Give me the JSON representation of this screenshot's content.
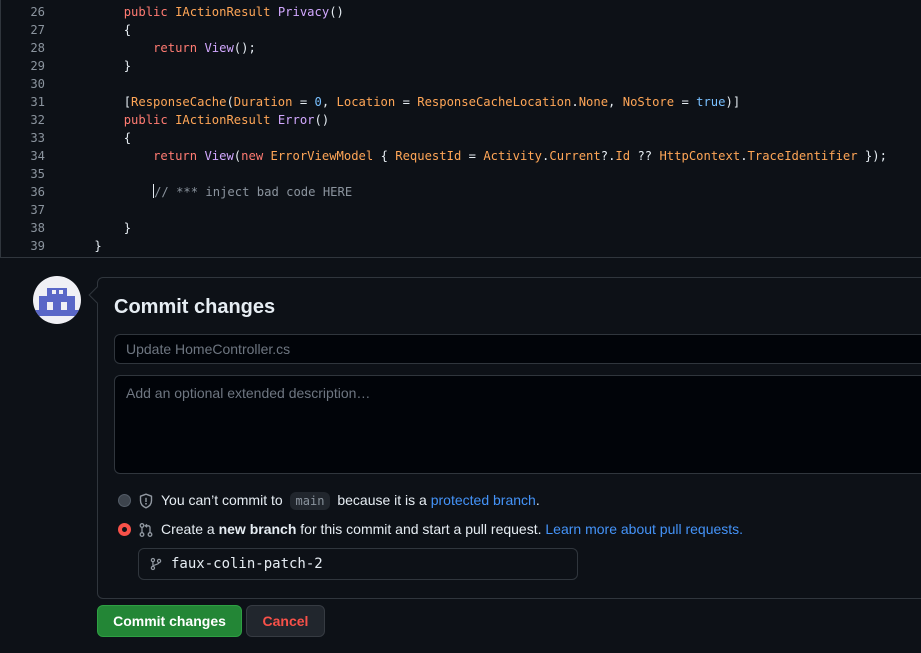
{
  "editor": {
    "lines": [
      {
        "num": "26",
        "indent": "        ",
        "tokens": [
          {
            "c": "k",
            "t": "public "
          },
          {
            "c": "t",
            "t": "IActionResult "
          },
          {
            "c": "f",
            "t": "Privacy"
          },
          {
            "c": "p",
            "t": "()"
          }
        ]
      },
      {
        "num": "27",
        "indent": "        ",
        "tokens": [
          {
            "c": "p",
            "t": "{"
          }
        ]
      },
      {
        "num": "28",
        "indent": "            ",
        "tokens": [
          {
            "c": "k",
            "t": "return "
          },
          {
            "c": "f",
            "t": "View"
          },
          {
            "c": "p",
            "t": "();"
          }
        ]
      },
      {
        "num": "29",
        "indent": "        ",
        "tokens": [
          {
            "c": "p",
            "t": "}"
          }
        ]
      },
      {
        "num": "30",
        "indent": "",
        "tokens": []
      },
      {
        "num": "31",
        "indent": "        ",
        "tokens": [
          {
            "c": "p",
            "t": "["
          },
          {
            "c": "t",
            "t": "ResponseCache"
          },
          {
            "c": "p",
            "t": "("
          },
          {
            "c": "t",
            "t": "Duration"
          },
          {
            "c": "p",
            "t": " = "
          },
          {
            "c": "n",
            "t": "0"
          },
          {
            "c": "p",
            "t": ", "
          },
          {
            "c": "t",
            "t": "Location"
          },
          {
            "c": "p",
            "t": " = "
          },
          {
            "c": "t",
            "t": "ResponseCacheLocation"
          },
          {
            "c": "p",
            "t": "."
          },
          {
            "c": "t",
            "t": "None"
          },
          {
            "c": "p",
            "t": ", "
          },
          {
            "c": "t",
            "t": "NoStore"
          },
          {
            "c": "p",
            "t": " = "
          },
          {
            "c": "n",
            "t": "true"
          },
          {
            "c": "p",
            "t": ")]"
          }
        ]
      },
      {
        "num": "32",
        "indent": "        ",
        "tokens": [
          {
            "c": "k",
            "t": "public "
          },
          {
            "c": "t",
            "t": "IActionResult "
          },
          {
            "c": "f",
            "t": "Error"
          },
          {
            "c": "p",
            "t": "()"
          }
        ]
      },
      {
        "num": "33",
        "indent": "        ",
        "tokens": [
          {
            "c": "p",
            "t": "{"
          }
        ]
      },
      {
        "num": "34",
        "indent": "            ",
        "tokens": [
          {
            "c": "k",
            "t": "return "
          },
          {
            "c": "f",
            "t": "View"
          },
          {
            "c": "p",
            "t": "("
          },
          {
            "c": "k",
            "t": "new "
          },
          {
            "c": "t",
            "t": "ErrorViewModel"
          },
          {
            "c": "p",
            "t": " { "
          },
          {
            "c": "t",
            "t": "RequestId"
          },
          {
            "c": "p",
            "t": " = "
          },
          {
            "c": "t",
            "t": "Activity"
          },
          {
            "c": "p",
            "t": "."
          },
          {
            "c": "t",
            "t": "Current"
          },
          {
            "c": "p",
            "t": "?."
          },
          {
            "c": "t",
            "t": "Id"
          },
          {
            "c": "p",
            "t": " ?? "
          },
          {
            "c": "t",
            "t": "HttpContext"
          },
          {
            "c": "p",
            "t": "."
          },
          {
            "c": "t",
            "t": "TraceIdentifier"
          },
          {
            "c": "p",
            "t": " });"
          }
        ]
      },
      {
        "num": "35",
        "indent": "",
        "tokens": []
      },
      {
        "num": "36",
        "indent": "            ",
        "cursor": true,
        "tokens": [
          {
            "c": "c",
            "t": "// *** inject bad code HERE"
          }
        ]
      },
      {
        "num": "37",
        "indent": "",
        "tokens": []
      },
      {
        "num": "38",
        "indent": "        ",
        "tokens": [
          {
            "c": "p",
            "t": "}"
          }
        ]
      },
      {
        "num": "39",
        "indent": "    ",
        "tokens": [
          {
            "c": "p",
            "t": "}"
          }
        ]
      }
    ]
  },
  "commit": {
    "title": "Commit changes",
    "summary_placeholder": "Update HomeController.cs",
    "description_placeholder": "Add an optional extended description…",
    "option_direct": {
      "prefix": "You can’t commit to",
      "branch": "main",
      "middle": "because it is a",
      "link": "protected branch",
      "suffix": "."
    },
    "option_new_branch": {
      "prefix": "Create a",
      "bold": "new branch",
      "middle": "for this commit and start a pull request.",
      "link": "Learn more about pull requests."
    },
    "branch_name": "faux-colin-patch-2",
    "submit_label": "Commit changes",
    "cancel_label": "Cancel"
  },
  "colors": {
    "accent_green": "#238636",
    "danger": "#f85149",
    "link": "#4493f8"
  },
  "icons": [
    "shield-icon",
    "git-pull-request-icon",
    "git-branch-icon"
  ]
}
